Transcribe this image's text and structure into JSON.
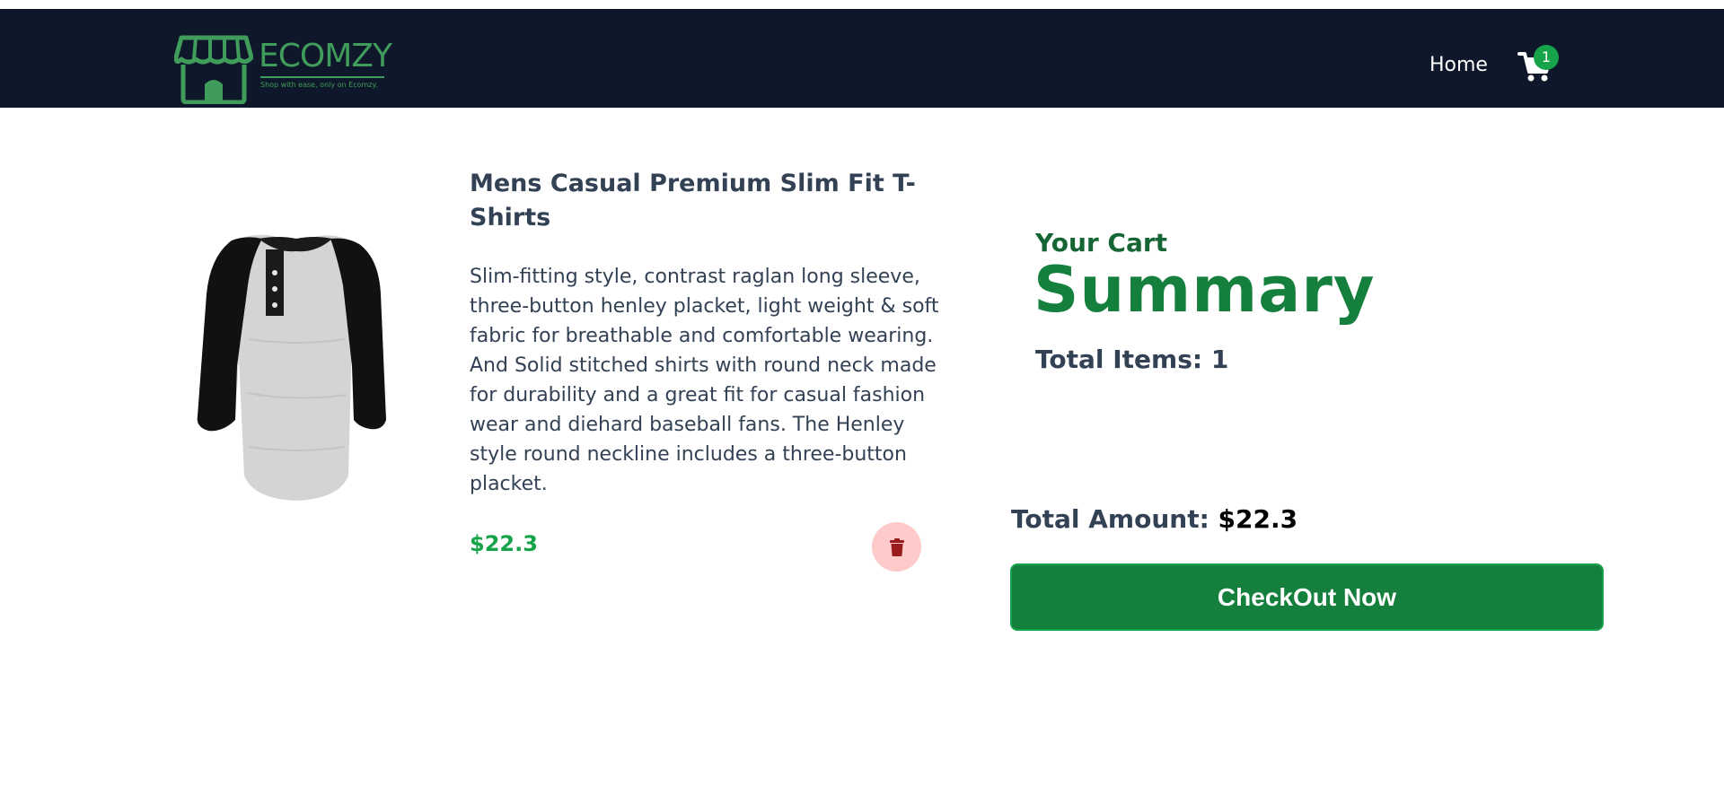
{
  "brand": {
    "name": "ECOMZY",
    "tagline": "Shop with ease, only on Ecomzy.",
    "color": "#3f9c5a"
  },
  "nav": {
    "home_label": "Home",
    "cart_count": "1",
    "cart_icon": "shopping-cart-icon"
  },
  "product": {
    "title": "Mens Casual Premium Slim Fit T-Shirts",
    "description": "Slim-fitting style, contrast raglan long sleeve, three-button henley placket, light weight & soft fabric for breathable and comfortable wearing. And Solid stitched shirts with round neck made for durability and a great fit for casual fashion wear and diehard baseball fans. The Henley style round neckline includes a three-button placket.",
    "price": "$22.3",
    "image_icon": "henley-tshirt-image",
    "delete_icon": "trash-icon"
  },
  "summary": {
    "cart_label": "Your Cart",
    "heading": "Summary",
    "total_items_label": "Total Items: 1",
    "total_amount_label": "Total Amount:",
    "total_amount_value": "$22.3",
    "checkout_label": "CheckOut Now"
  },
  "colors": {
    "navbar": "#0f172a",
    "accent": "#15803d",
    "price": "#16a34a",
    "delete_bg": "#fecaca"
  }
}
